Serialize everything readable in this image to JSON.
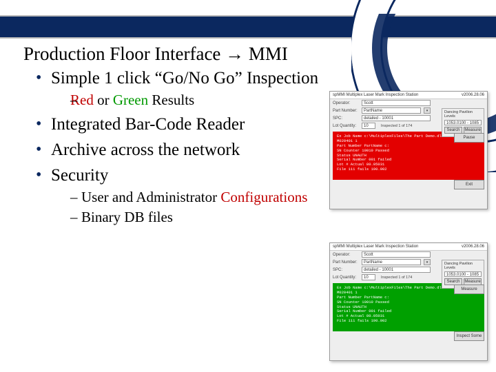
{
  "title_parts": {
    "a": "Production Floor Interface ",
    "arrow": "→",
    "b": " MMI"
  },
  "bullets": {
    "b1": "Simple 1 click “Go/No Go” Inspection",
    "b1_sub": {
      "pre": "– ",
      "red": "Red",
      "mid": " or ",
      "green": "Green",
      "post": " Results"
    },
    "b2": "Integrated Bar-Code Reader",
    "b3": "Archive across the network",
    "b4": "Security",
    "b4_sub1_pre": "User and Administrator ",
    "b4_sub1_em": "Configurations",
    "b4_sub2": "Binary DB files"
  },
  "thumb": {
    "app_title": "spMMI Multiplex Laser Mark Inspection Station",
    "version": "v2006.28.06",
    "labels": {
      "operator": "Operator:",
      "part": "Part Number:",
      "spc": "SPC:",
      "qty": "Lot Quantity:"
    },
    "fields": {
      "operator": "Scott",
      "part": "PartName",
      "spc": "detailed - 10001",
      "qty": "10",
      "prog": "Inspected 1 of 174"
    },
    "box": {
      "title": "Dancing Pavilion Levels",
      "levels": "1053.0100 - 1085"
    },
    "btns": {
      "search": "Search",
      "measure": "Measure",
      "pause": "Pause",
      "inspect": "Inspect Some",
      "exit": "Exit"
    },
    "panel_head": "Ex Job Name c:\\MultiplexFiles\\The Part Demo.dll - LMS-10-C2 M020401 1",
    "panel_lines": [
      "Part Number PartName c:",
      "SN Counter 10010 Passed",
      "Status UNAUTH",
      "Serial Number 001 failed",
      "Lot # Actual 80.05031",
      "File 111 fails 190.002"
    ]
  }
}
